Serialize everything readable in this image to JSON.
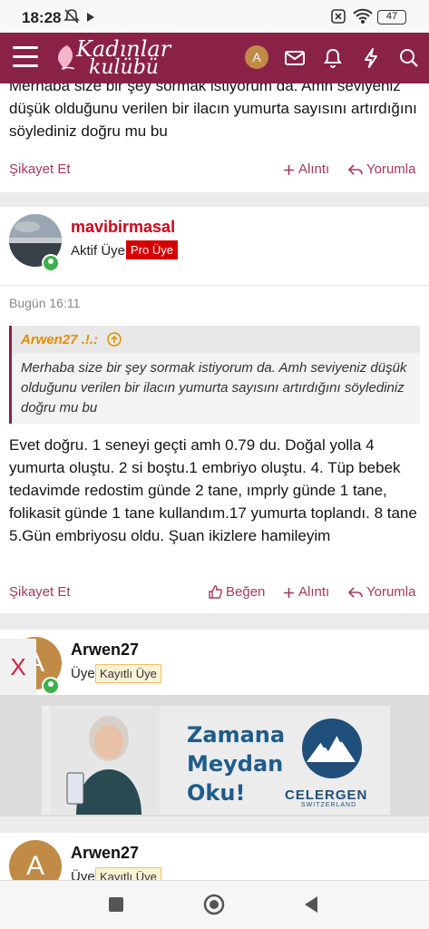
{
  "status_bar": {
    "time": "18:28",
    "battery": "47"
  },
  "header": {
    "logo_line1": "Kadınlar",
    "logo_line2": "kulübü",
    "avatar_letter": "A"
  },
  "post_top": {
    "text": "Merhaba size bir şey sormak istiyorum da. Amh seviyeniz düşük olduğunu verilen bir ilacın yumurta sayısını artırdığını söylediniz doğru mu bu",
    "report": "Şikayet Et",
    "quote": "Alıntı",
    "reply": "Yorumla"
  },
  "post_main": {
    "username": "mavibirmasal",
    "role": "Aktif Üye",
    "badge": "Pro Üye",
    "date": "Bugün 16:11",
    "quote_author": "Arwen27 .!.:",
    "quote_text": "Merhaba size bir şey sormak istiyorum da. Amh seviyeniz düşük olduğunu verilen bir ilacın yumurta sayısını artırdığını söylediniz doğru mu bu",
    "text": "Evet doğru. 1 seneyi geçti amh 0.79 du. Doğal yolla 4 yumurta oluştu. 2 si boştu.1 embriyo oluştu. 4. Tüp bebek tedavimde redostim günde 2 tane, ımprly günde 1 tane, folikasit günde 1 tane kullandım.17 yumurta toplandı. 8 tane 5.Gün embriyosu oldu. Şuan ikizlere hamileyim",
    "report": "Şikayet Et",
    "like": "Beğen",
    "quote": "Alıntı",
    "reply": "Yorumla"
  },
  "post_third": {
    "username": "Arwen27",
    "role": "Üye",
    "badge": "Kayıtlı Üye",
    "avatar_letter": "A"
  },
  "ad": {
    "close": "X",
    "line1": "Zamana",
    "line2": "Meydan",
    "line3": "Oku!",
    "brand": "CELERGEN",
    "brand_sub": "SWITZERLAND"
  },
  "post_fourth": {
    "username": "Arwen27",
    "role": "Üye",
    "badge": "Kayıtlı Üye",
    "avatar_letter": "A"
  },
  "colors": {
    "brand": "#8a2248",
    "action": "#a23a5f",
    "username_red": "#d0021b",
    "online": "#3eb04b"
  }
}
